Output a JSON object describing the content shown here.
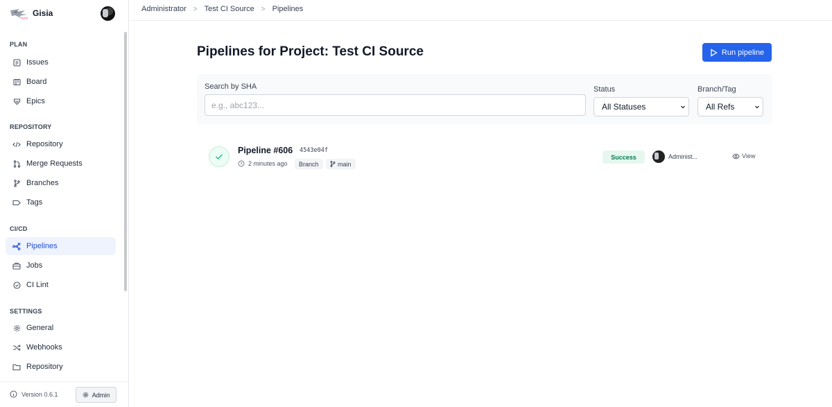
{
  "app": {
    "name": "Gisia"
  },
  "sidebar": {
    "sections": {
      "plan": {
        "title": "PLAN",
        "items": [
          {
            "label": "Issues",
            "icon": "issues-icon"
          },
          {
            "label": "Board",
            "icon": "board-icon"
          },
          {
            "label": "Epics",
            "icon": "epics-icon"
          }
        ]
      },
      "repository": {
        "title": "REPOSITORY",
        "items": [
          {
            "label": "Repository",
            "icon": "code-icon"
          },
          {
            "label": "Merge Requests",
            "icon": "merge-request-icon"
          },
          {
            "label": "Branches",
            "icon": "branch-icon"
          },
          {
            "label": "Tags",
            "icon": "tag-icon"
          }
        ]
      },
      "cicd": {
        "title": "CI/CD",
        "items": [
          {
            "label": "Pipelines",
            "icon": "pipeline-icon",
            "active": true
          },
          {
            "label": "Jobs",
            "icon": "jobs-icon"
          },
          {
            "label": "CI Lint",
            "icon": "check-circle-icon"
          }
        ]
      },
      "settings": {
        "title": "SETTINGS",
        "items": [
          {
            "label": "General",
            "icon": "gear-icon"
          },
          {
            "label": "Webhooks",
            "icon": "webhook-icon"
          },
          {
            "label": "Repository",
            "icon": "folder-icon"
          }
        ]
      }
    },
    "footer": {
      "version": "Version 0.6.1",
      "admin_label": "Admin"
    }
  },
  "breadcrumb": [
    "Administrator",
    "Test CI Source",
    "Pipelines"
  ],
  "breadcrumb_separator": ">",
  "page": {
    "title": "Pipelines for Project: Test CI Source",
    "run_button": "Run pipeline",
    "accent_color": "#2563eb"
  },
  "filters": {
    "search_label": "Search by SHA",
    "search_placeholder": "e.g., abc123...",
    "search_value": "",
    "status_label": "Status",
    "status_selected": "All Statuses",
    "ref_label": "Branch/Tag",
    "ref_selected": "All Refs"
  },
  "pipelines": [
    {
      "name": "Pipeline #606",
      "sha": "4543e04f",
      "time": "2 minutes ago",
      "ref_type": "Branch",
      "ref": "main",
      "status": "Success",
      "status_color": "#047857",
      "author": "Administ...",
      "view_label": "View"
    }
  ]
}
